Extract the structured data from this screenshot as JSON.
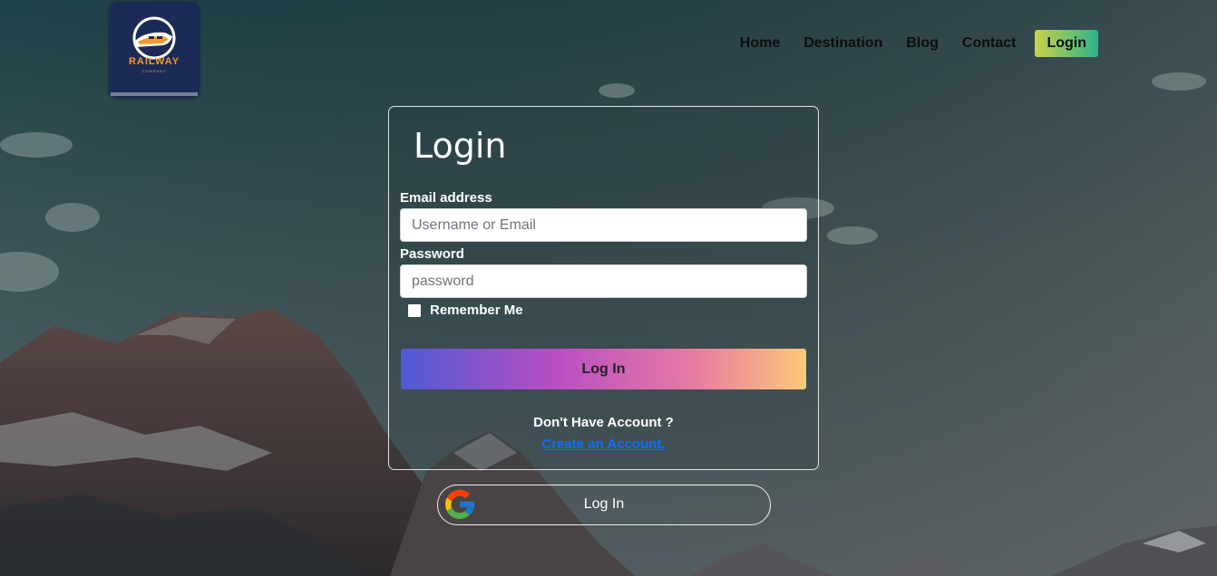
{
  "logo": {
    "text": "RAILWAY",
    "subtext": "COMPANY"
  },
  "nav": {
    "items": [
      "Home",
      "Destination",
      "Blog",
      "Contact"
    ],
    "login_label": "Login"
  },
  "form": {
    "title": "Login",
    "email_label": "Email address",
    "email_placeholder": "Username or Email",
    "password_label": "Password",
    "password_placeholder": "password",
    "remember_label": "Remember Me",
    "submit_label": "Log In",
    "no_account_text": "Don't Have Account ?",
    "create_account_label": "Create an Account."
  },
  "google": {
    "label": "Log In",
    "icon": "google-icon"
  },
  "colors": {
    "brand_navy": "#1c2a56",
    "logo_orange": "#f29a2e",
    "link_blue": "#0d6efd",
    "nav_login_gradient": [
      "#c9d34a",
      "#2bb38a"
    ],
    "submit_gradient": [
      "#4f5bd5",
      "#b94ec4",
      "#e67aa3",
      "#fbc879"
    ]
  }
}
